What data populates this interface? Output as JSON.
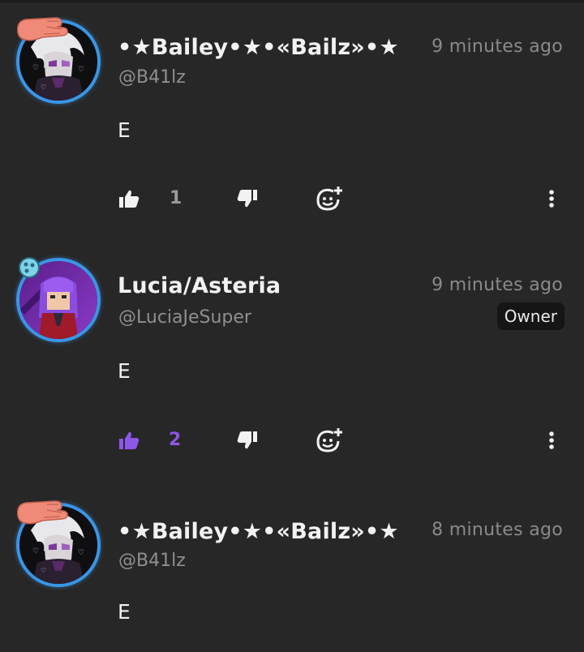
{
  "colors": {
    "background": "#272727",
    "text_primary": "#f2f2f2",
    "text_muted": "#8f8f8f",
    "like_active": "#8d57e8",
    "avatar_ring": "#3a96e6",
    "badge_bg": "#151515"
  },
  "comments": [
    {
      "username": "•★Bailey•★•«Bailz»•★",
      "handle": "@B41lz",
      "time": "9 minutes ago",
      "text": "E",
      "like_count": "1",
      "liked": false,
      "badge": "",
      "avatar_icon": "avatar-bailey-icon"
    },
    {
      "username": "Lucia/Asteria",
      "handle": "@LuciaJeSuper",
      "time": "9 minutes ago",
      "text": "E",
      "like_count": "2",
      "liked": true,
      "badge": "Owner",
      "avatar_icon": "avatar-lucia-icon"
    },
    {
      "username": "•★Bailey•★•«Bailz»•★",
      "handle": "@B41lz",
      "time": "8 minutes ago",
      "text": "E",
      "like_count": "",
      "liked": false,
      "badge": "",
      "avatar_icon": "avatar-bailey-icon"
    }
  ],
  "icons": {
    "like": "thumbs-up-icon",
    "dislike": "thumbs-down-icon",
    "react": "add-reaction-icon",
    "more": "more-vertical-icon"
  }
}
